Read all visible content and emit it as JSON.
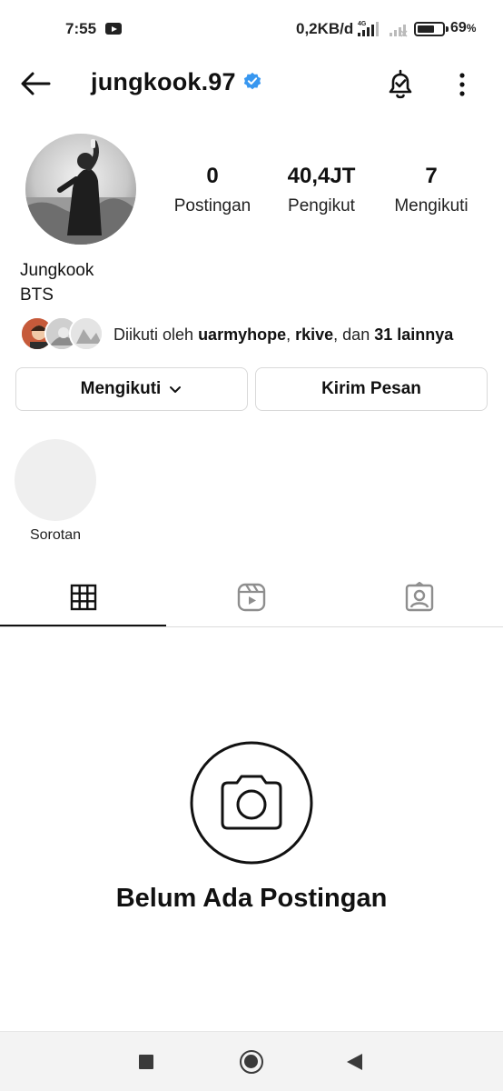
{
  "status_bar": {
    "time": "7:55",
    "net_speed": "0,2KB/d",
    "network_label": "4G",
    "battery_pct": "69",
    "battery_unit": "%",
    "battery_level": 0.69
  },
  "header": {
    "username": "jungkook.97",
    "verified": true,
    "accent_color": "#3897f0"
  },
  "profile": {
    "stats": [
      {
        "value": "0",
        "label": "Postingan"
      },
      {
        "value": "40,4JT",
        "label": "Pengikut"
      },
      {
        "value": "7",
        "label": "Mengikuti"
      }
    ],
    "name": "Jungkook",
    "bio": "BTS",
    "followed_by": {
      "prefix": "Diikuti oleh",
      "user1": "uarmyhope",
      "sep": ",",
      "user2": "rkive",
      "conj": ", dan",
      "others": "31 lainnya"
    }
  },
  "actions": {
    "following_label": "Mengikuti",
    "message_label": "Kirim Pesan"
  },
  "highlights": {
    "label": "Sorotan"
  },
  "tabs": [
    {
      "icon": "grid-icon",
      "active": true
    },
    {
      "icon": "reels-icon",
      "active": false
    },
    {
      "icon": "tagged-icon",
      "active": false
    }
  ],
  "empty_state": {
    "icon": "camera-icon",
    "title": "Belum Ada Postingan"
  }
}
